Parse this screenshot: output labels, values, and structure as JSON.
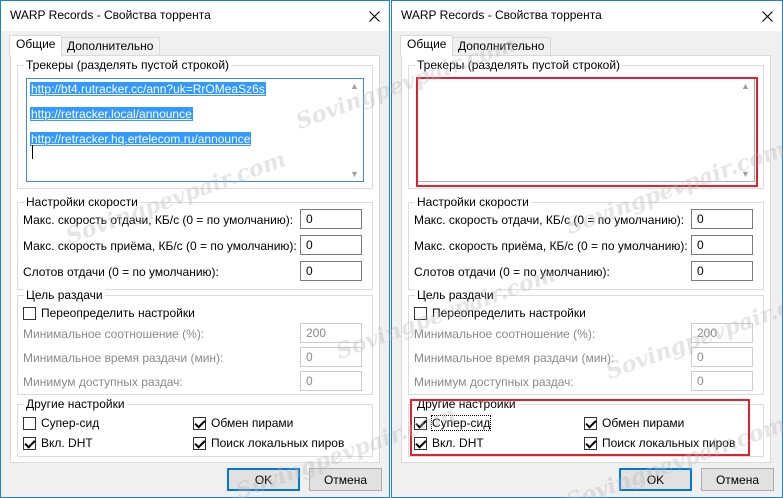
{
  "dialog": {
    "title": "WARP Records - Свойства торрента",
    "tabs": [
      "Общие",
      "Дополнительно"
    ],
    "trackers": {
      "legend": "Трекеры (разделять пустой строкой)",
      "lines": [
        "http://bt4.rutracker.cc/ann?uk=RrOMeaSz6s",
        "http://retracker.local/announce",
        "http://retracker.hq.ertelecom.ru/announce"
      ]
    },
    "speed": {
      "legend": "Настройки скорости",
      "upload_label": "Макс. скорость отдачи, КБ/с (0 = по умолчанию):",
      "upload_value": "0",
      "download_label": "Макс. скорость приёма, КБ/с (0 = по умолчанию):",
      "download_value": "0",
      "slots_label": "Слотов отдачи (0 = по умолчанию):",
      "slots_value": "0"
    },
    "seeding": {
      "legend": "Цель раздачи",
      "override_label": "Переопределить настройки",
      "override_checked": false,
      "min_ratio_label": "Минимальное соотношение (%):",
      "min_ratio_value": "200",
      "min_time_label": "Минимальное время раздачи (мин):",
      "min_time_value": "0",
      "min_seeds_label": "Минимум доступных раздач:",
      "min_seeds_value": "0"
    },
    "other": {
      "legend": "Другие настройки",
      "superseed_label": "Супер-сид",
      "pex_label": "Обмен пирами",
      "dht_label": "Вкл. DHT",
      "lpd_label": "Поиск локальных пиров",
      "left": {
        "superseed": false,
        "pex": true,
        "dht": true,
        "lpd": true
      },
      "right": {
        "superseed": true,
        "pex": true,
        "dht": true,
        "lpd": true
      }
    },
    "ok_label": "OK",
    "cancel_label": "Отмена"
  },
  "watermark_text": "Sovingpevpair.com",
  "highlight_color": "#e02030",
  "icons": {
    "close": "close-icon",
    "checkmark": "checkmark-icon"
  }
}
